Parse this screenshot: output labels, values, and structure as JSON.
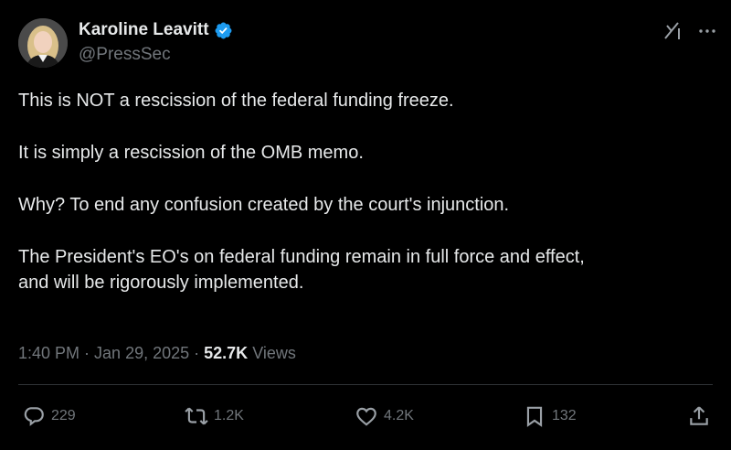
{
  "author": {
    "display_name": "Karoline Leavitt",
    "handle": "@PressSec",
    "verified_badge": "verified-check-icon",
    "verified_color": "#1d9bf0"
  },
  "header_icons": [
    "grok-icon",
    "more-icon"
  ],
  "tweet": {
    "paragraphs": [
      "This is NOT a rescission of the federal funding freeze.",
      "It is simply a rescission of the OMB memo.",
      "Why? To end any confusion created by the court's injunction.",
      "The President's EO's on federal funding remain in full force and effect,",
      "and will be rigorously implemented."
    ]
  },
  "meta": {
    "time": "1:40 PM",
    "dot": "·",
    "date": "Jan 29, 2025",
    "views_count": "52.7K",
    "views_label": "Views"
  },
  "actions": {
    "reply": {
      "icon": "reply-icon",
      "count": "229"
    },
    "repost": {
      "icon": "repost-icon",
      "count": "1.2K"
    },
    "like": {
      "icon": "heart-icon",
      "count": "4.2K"
    },
    "bookmark": {
      "icon": "bookmark-icon",
      "count": "132"
    },
    "share": {
      "icon": "share-icon"
    }
  },
  "colors": {
    "background": "#000000",
    "text_primary": "#e7e9ea",
    "text_secondary": "#71767b",
    "divider": "#2f3336"
  }
}
